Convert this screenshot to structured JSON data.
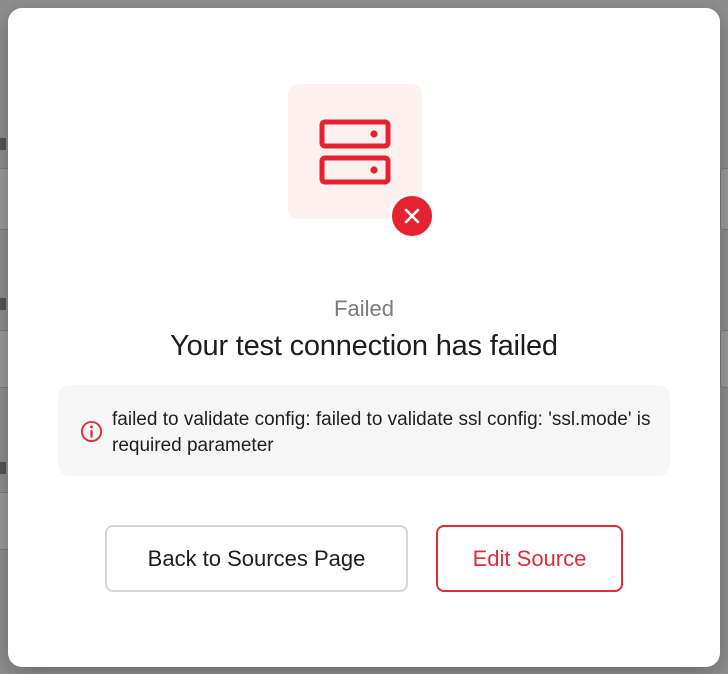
{
  "modal": {
    "status_label": "Failed",
    "title": "Your test connection has failed",
    "error_message": "failed to validate config: failed to validate ssl config: 'ssl.mode' is required parameter",
    "buttons": {
      "back_label": "Back to Sources Page",
      "edit_label": "Edit Source"
    },
    "icons": {
      "main": "server-icon",
      "badge": "close-icon",
      "message": "info-icon"
    }
  },
  "colors": {
    "accent_red": "#e02d39",
    "badge_red": "#e5222f",
    "icon_bg": "#fdf1f0",
    "message_bg": "#f6f6f6",
    "overlay": "#8e8e8e"
  }
}
